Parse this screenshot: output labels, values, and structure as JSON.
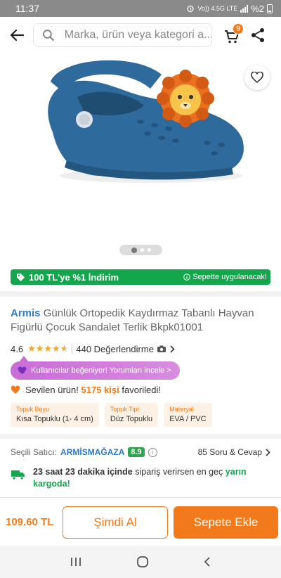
{
  "status_bar": {
    "time": "11:37",
    "network": "Vo)) 4.5G LTE",
    "battery": "%2"
  },
  "header": {
    "search_placeholder": "Marka, ürün veya kategori a...",
    "cart_count": "9"
  },
  "discount_banner": {
    "text": "100 TL'ye %1 İndirim",
    "note": "Sepette uygulanacak!"
  },
  "product": {
    "brand": "Armis",
    "title": "Günlük Ortopedik Kaydırmaz Tabanlı Hayvan Figürlü Çocuk Sandalet Terlik Bkpk01001",
    "rating": "4.6",
    "rating_value": 4.6,
    "reviews": "440 Değerlendirme",
    "reviews_pill": "Kullanıcılar beğeniyor! Yorumları incele >",
    "favorite_prefix": "Sevilen ürün!",
    "favorite_count": "5175 kişi",
    "favorite_suffix": "favoriledi!",
    "attributes": [
      {
        "label": "Topuk Boyu",
        "value": "Kısa Topuklu (1- 4 cm)"
      },
      {
        "label": "Topuk Tipi",
        "value": "Düz Topuklu"
      },
      {
        "label": "Materyal",
        "value": "EVA / PVC"
      }
    ]
  },
  "seller": {
    "label": "Seçili Satıcı:",
    "name": "ARMİSMAĞAZA",
    "score": "8.9",
    "qa": "85 Soru & Cevap"
  },
  "delivery": {
    "time": "23 saat 23 dakika içinde",
    "text": "sipariş verirsen en geç",
    "date": "yarın kargoda!"
  },
  "bottom": {
    "price": "109.60 TL",
    "buy_now": "Şimdi Al",
    "add_to_cart": "Sepete Ekle"
  },
  "colors": {
    "accent": "#f27a1a",
    "green": "#12a74d",
    "brand_blue": "#2a79c6",
    "shoe": "#2f6a9c"
  }
}
